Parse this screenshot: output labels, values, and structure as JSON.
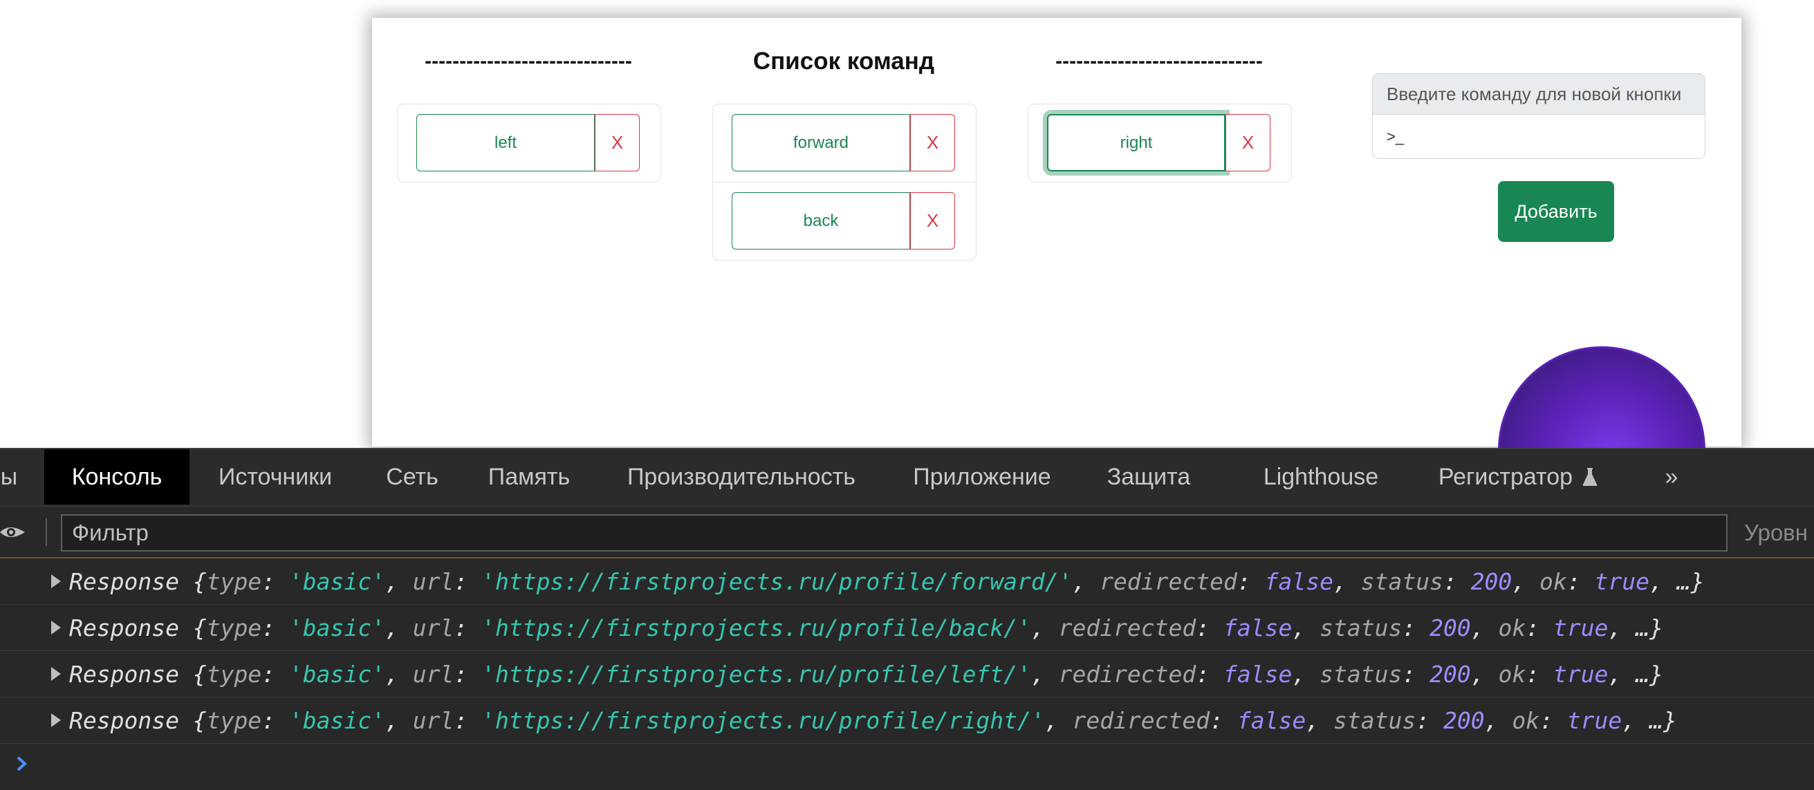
{
  "page": {
    "columns": [
      {
        "title": "------------------------------",
        "commands": [
          {
            "label": "left",
            "delete_label": "X",
            "focused": false
          }
        ]
      },
      {
        "title": "Список команд",
        "commands": [
          {
            "label": "forward",
            "delete_label": "X",
            "focused": false
          },
          {
            "label": "back",
            "delete_label": "X",
            "focused": false
          }
        ]
      },
      {
        "title": "------------------------------",
        "commands": [
          {
            "label": "right",
            "delete_label": "X",
            "focused": true
          }
        ]
      }
    ],
    "form": {
      "label": "Введите команду для новой кнопки",
      "input_value": ">_",
      "add_button": "Добавить"
    }
  },
  "devtools": {
    "tabs": [
      {
        "label": "ы",
        "active": false
      },
      {
        "label": "Консоль",
        "active": true
      },
      {
        "label": "Источники",
        "active": false
      },
      {
        "label": "Сеть",
        "active": false
      },
      {
        "label": "Память",
        "active": false
      },
      {
        "label": "Производительность",
        "active": false
      },
      {
        "label": "Приложение",
        "active": false
      },
      {
        "label": "Защита",
        "active": false
      },
      {
        "label": "Lighthouse",
        "active": false
      },
      {
        "label": "Регистратор",
        "active": false
      }
    ],
    "more_tabs_glyph": "»",
    "filter_placeholder": "Фильтр",
    "levels_label": "Уровн",
    "console": [
      {
        "class_name": "Response",
        "type": "'basic'",
        "url": "'https://firstprojects.ru/profile/forward/'",
        "redirected": "false",
        "status": "200",
        "ok": "true",
        "ellipsis": "…"
      },
      {
        "class_name": "Response",
        "type": "'basic'",
        "url": "'https://firstprojects.ru/profile/back/'",
        "redirected": "false",
        "status": "200",
        "ok": "true",
        "ellipsis": "…"
      },
      {
        "class_name": "Response",
        "type": "'basic'",
        "url": "'https://firstprojects.ru/profile/left/'",
        "redirected": "false",
        "status": "200",
        "ok": "true",
        "ellipsis": "…"
      },
      {
        "class_name": "Response",
        "type": "'basic'",
        "url": "'https://firstprojects.ru/profile/right/'",
        "redirected": "false",
        "status": "200",
        "ok": "true",
        "ellipsis": "…"
      }
    ],
    "keys": {
      "type": "type",
      "url": "url",
      "redirected": "redirected",
      "status": "status",
      "ok": "ok"
    }
  },
  "colors": {
    "success": "#198754",
    "danger": "#dc3545",
    "devtools_bg": "#282828",
    "string": "#35c6b0",
    "literal": "#9b8cff"
  },
  "icons": [
    "eye-icon",
    "flask-icon",
    "more-tabs-icon",
    "expand-caret-icon",
    "prompt-chevron-icon"
  ]
}
